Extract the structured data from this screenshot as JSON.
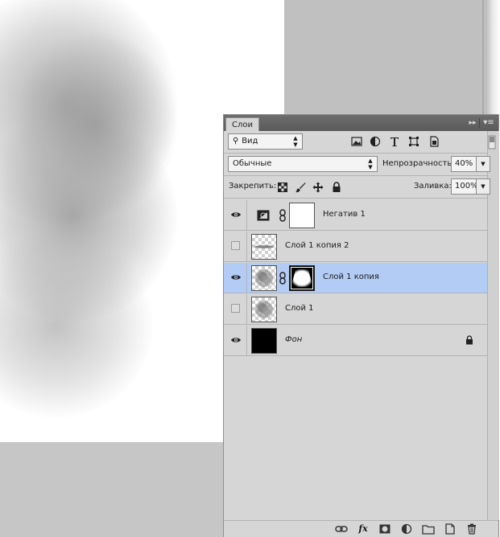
{
  "panel": {
    "tab_label": "Слои",
    "collapse_glyph": "▸▸",
    "menu_glyph": "▾≡"
  },
  "filter": {
    "kind_label": "Вид",
    "icons": [
      "image-filter-icon",
      "adjustment-filter-icon",
      "type-filter-icon",
      "shape-filter-icon",
      "smart-object-filter-icon"
    ]
  },
  "blend": {
    "mode_label": "Обычные",
    "opacity_label": "Непрозрачность:",
    "opacity_value": "40%"
  },
  "lock": {
    "label": "Закрепить:",
    "fill_label": "Заливка:",
    "fill_value": "100%",
    "icons": [
      "lock-transparent-pixels-icon",
      "lock-image-pixels-icon",
      "lock-position-icon",
      "lock-all-icon"
    ]
  },
  "layers": [
    {
      "name": "Негатив 1",
      "visible": true,
      "selected": false,
      "type": "adjustment",
      "has_mask": true,
      "italic": false,
      "locked": false
    },
    {
      "name": "Слой 1 копия 2",
      "visible": false,
      "selected": false,
      "type": "pixel-streak",
      "has_mask": false,
      "italic": false,
      "locked": false
    },
    {
      "name": "Слой 1 копия",
      "visible": true,
      "selected": true,
      "type": "pixel-cloud",
      "has_mask": true,
      "italic": false,
      "locked": false
    },
    {
      "name": "Слой 1",
      "visible": false,
      "selected": false,
      "type": "pixel-cloud",
      "has_mask": false,
      "italic": false,
      "locked": false
    },
    {
      "name": "Фон",
      "visible": true,
      "selected": false,
      "type": "background",
      "has_mask": false,
      "italic": true,
      "locked": true
    }
  ],
  "toolbar": {
    "fx_label": "fx",
    "icons": [
      "link-layers-icon",
      "fx-icon",
      "add-mask-icon",
      "new-adjustment-icon",
      "new-group-icon",
      "new-layer-icon",
      "delete-layer-icon"
    ]
  },
  "colors": {
    "selection": "#b3ccf5",
    "panel_bg": "#d6d6d6",
    "titlebar": "#5a5a5a",
    "workspace": "#c0c0c0"
  }
}
